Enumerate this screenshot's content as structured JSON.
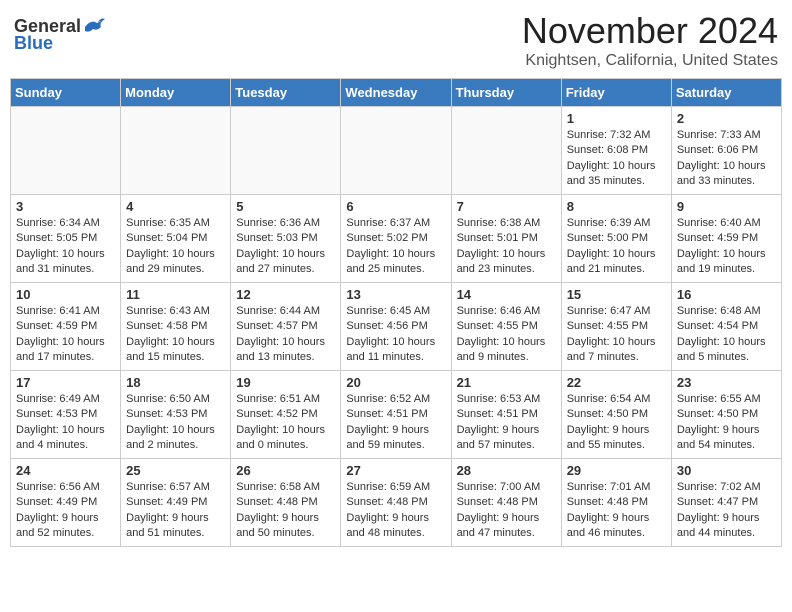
{
  "header": {
    "logo_general": "General",
    "logo_blue": "Blue",
    "month_title": "November 2024",
    "location": "Knightsen, California, United States"
  },
  "days_of_week": [
    "Sunday",
    "Monday",
    "Tuesday",
    "Wednesday",
    "Thursday",
    "Friday",
    "Saturday"
  ],
  "weeks": [
    [
      {
        "day": "",
        "info": ""
      },
      {
        "day": "",
        "info": ""
      },
      {
        "day": "",
        "info": ""
      },
      {
        "day": "",
        "info": ""
      },
      {
        "day": "",
        "info": ""
      },
      {
        "day": "1",
        "info": "Sunrise: 7:32 AM\nSunset: 6:08 PM\nDaylight: 10 hours and 35 minutes."
      },
      {
        "day": "2",
        "info": "Sunrise: 7:33 AM\nSunset: 6:06 PM\nDaylight: 10 hours and 33 minutes."
      }
    ],
    [
      {
        "day": "3",
        "info": "Sunrise: 6:34 AM\nSunset: 5:05 PM\nDaylight: 10 hours and 31 minutes."
      },
      {
        "day": "4",
        "info": "Sunrise: 6:35 AM\nSunset: 5:04 PM\nDaylight: 10 hours and 29 minutes."
      },
      {
        "day": "5",
        "info": "Sunrise: 6:36 AM\nSunset: 5:03 PM\nDaylight: 10 hours and 27 minutes."
      },
      {
        "day": "6",
        "info": "Sunrise: 6:37 AM\nSunset: 5:02 PM\nDaylight: 10 hours and 25 minutes."
      },
      {
        "day": "7",
        "info": "Sunrise: 6:38 AM\nSunset: 5:01 PM\nDaylight: 10 hours and 23 minutes."
      },
      {
        "day": "8",
        "info": "Sunrise: 6:39 AM\nSunset: 5:00 PM\nDaylight: 10 hours and 21 minutes."
      },
      {
        "day": "9",
        "info": "Sunrise: 6:40 AM\nSunset: 4:59 PM\nDaylight: 10 hours and 19 minutes."
      }
    ],
    [
      {
        "day": "10",
        "info": "Sunrise: 6:41 AM\nSunset: 4:59 PM\nDaylight: 10 hours and 17 minutes."
      },
      {
        "day": "11",
        "info": "Sunrise: 6:43 AM\nSunset: 4:58 PM\nDaylight: 10 hours and 15 minutes."
      },
      {
        "day": "12",
        "info": "Sunrise: 6:44 AM\nSunset: 4:57 PM\nDaylight: 10 hours and 13 minutes."
      },
      {
        "day": "13",
        "info": "Sunrise: 6:45 AM\nSunset: 4:56 PM\nDaylight: 10 hours and 11 minutes."
      },
      {
        "day": "14",
        "info": "Sunrise: 6:46 AM\nSunset: 4:55 PM\nDaylight: 10 hours and 9 minutes."
      },
      {
        "day": "15",
        "info": "Sunrise: 6:47 AM\nSunset: 4:55 PM\nDaylight: 10 hours and 7 minutes."
      },
      {
        "day": "16",
        "info": "Sunrise: 6:48 AM\nSunset: 4:54 PM\nDaylight: 10 hours and 5 minutes."
      }
    ],
    [
      {
        "day": "17",
        "info": "Sunrise: 6:49 AM\nSunset: 4:53 PM\nDaylight: 10 hours and 4 minutes."
      },
      {
        "day": "18",
        "info": "Sunrise: 6:50 AM\nSunset: 4:53 PM\nDaylight: 10 hours and 2 minutes."
      },
      {
        "day": "19",
        "info": "Sunrise: 6:51 AM\nSunset: 4:52 PM\nDaylight: 10 hours and 0 minutes."
      },
      {
        "day": "20",
        "info": "Sunrise: 6:52 AM\nSunset: 4:51 PM\nDaylight: 9 hours and 59 minutes."
      },
      {
        "day": "21",
        "info": "Sunrise: 6:53 AM\nSunset: 4:51 PM\nDaylight: 9 hours and 57 minutes."
      },
      {
        "day": "22",
        "info": "Sunrise: 6:54 AM\nSunset: 4:50 PM\nDaylight: 9 hours and 55 minutes."
      },
      {
        "day": "23",
        "info": "Sunrise: 6:55 AM\nSunset: 4:50 PM\nDaylight: 9 hours and 54 minutes."
      }
    ],
    [
      {
        "day": "24",
        "info": "Sunrise: 6:56 AM\nSunset: 4:49 PM\nDaylight: 9 hours and 52 minutes."
      },
      {
        "day": "25",
        "info": "Sunrise: 6:57 AM\nSunset: 4:49 PM\nDaylight: 9 hours and 51 minutes."
      },
      {
        "day": "26",
        "info": "Sunrise: 6:58 AM\nSunset: 4:48 PM\nDaylight: 9 hours and 50 minutes."
      },
      {
        "day": "27",
        "info": "Sunrise: 6:59 AM\nSunset: 4:48 PM\nDaylight: 9 hours and 48 minutes."
      },
      {
        "day": "28",
        "info": "Sunrise: 7:00 AM\nSunset: 4:48 PM\nDaylight: 9 hours and 47 minutes."
      },
      {
        "day": "29",
        "info": "Sunrise: 7:01 AM\nSunset: 4:48 PM\nDaylight: 9 hours and 46 minutes."
      },
      {
        "day": "30",
        "info": "Sunrise: 7:02 AM\nSunset: 4:47 PM\nDaylight: 9 hours and 44 minutes."
      }
    ]
  ]
}
